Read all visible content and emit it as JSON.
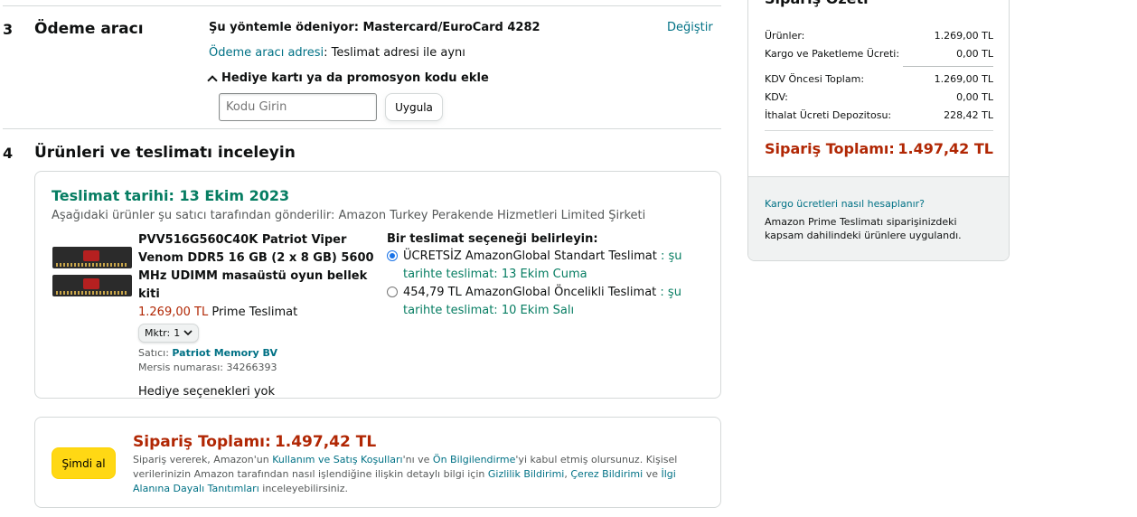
{
  "payment": {
    "step_number": "3",
    "step_title": "Ödeme aracı",
    "method_line": "Şu yöntemle ödeniyor: Mastercard/EuroCard 4282",
    "change_link": "Değiştir",
    "address_link": "Ödeme aracı adresi",
    "address_value": ": Teslimat adresi ile aynı",
    "promo_toggle": "Hediye kartı ya da promosyon kodu ekle",
    "promo_placeholder": "Kodu Girin",
    "apply_button": "Uygula"
  },
  "review": {
    "step_number": "4",
    "step_title": "Ürünleri ve teslimatı inceleyin",
    "delivery_date": "Teslimat tarihi: 13 Ekim 2023",
    "seller_line": "Aşağıdaki ürünler şu satıcı tarafından gönderilir: Amazon Turkey Perakende Hizmetleri Limited Şirketi",
    "product": {
      "title_lines": [
        "PVV516G560C40K Patriot Viper",
        "Venom DDR5 16 GB (2 x 8 GB) 5600",
        "MHz UDIMM masaüstü oyun bellek kiti"
      ],
      "price": "1.269,00 TL",
      "price_suffix": " Prime Teslimat",
      "qty_label": "Mktr:",
      "qty_value": "1",
      "seller_label": "Satıcı:",
      "seller_name": "Patriot Memory BV",
      "mersis": "Mersis numarası: 34266393",
      "gift": "Hediye seçenekleri yok"
    },
    "options_heading": "Bir teslimat seçeneği belirleyin:",
    "options": [
      {
        "selected": true,
        "text": "ÜCRETSİZ AmazonGlobal Standart Teslimat",
        "sep": " : ",
        "date_lines": [
          "şu",
          "tarihte teslimat: 13 Ekim Cuma"
        ]
      },
      {
        "selected": false,
        "text": "454,79 TL AmazonGlobal Öncelikli Teslimat",
        "sep": " : ",
        "date_lines": [
          "şu",
          "tarihte teslimat: 10 Ekim Salı"
        ]
      }
    ]
  },
  "place_order": {
    "button": "Şimdi al",
    "total_label": "Sipariş Toplamı:",
    "total_value": "1.497,42 TL",
    "legal_1": "Sipariş vererek, Amazon'un ",
    "link_terms": "Kullanım ve Satış Koşulları",
    "legal_2": "'nı ve ",
    "link_preinfo": "Ön Bilgilendirme",
    "legal_3": "'yi kabul etmiş olursunuz. Kişisel",
    "legal_4": "verilerinizin Amazon tarafından nasıl işlendiğine ilişkin detaylı bilgi için ",
    "link_privacy": "Gizlilik Bildirimi",
    "legal_5": ", ",
    "link_cookie": "Çerez Bildirimi",
    "legal_6": " ve ",
    "link_ads_1": "İlgi",
    "link_ads_2": "Alanına Dayalı Tanıtımları",
    "legal_7": " inceleyebilirsiniz."
  },
  "summary": {
    "title": "Sipariş Özeti",
    "rows_a": [
      {
        "label": "Ürünler:",
        "value": "1.269,00 TL"
      },
      {
        "label": "Kargo ve Paketleme Ücreti:",
        "value": "0,00 TL"
      }
    ],
    "rows_b": [
      {
        "label": "KDV Öncesi Toplam:",
        "value": "1.269,00 TL"
      },
      {
        "label": "KDV:",
        "value": "0,00 TL"
      },
      {
        "label": "İthalat Ücreti Depozitosu:",
        "value": "228,42 TL"
      }
    ],
    "total_label": "Sipariş Toplamı:",
    "total_value": "1.497,42 TL",
    "shipping_link": "Kargo ücretleri nasıl hesaplanır?",
    "prime_note_1": "Amazon Prime Teslimatı siparişinizdeki",
    "prime_note_2": "kapsam dahilindeki ürünlere uygulandı."
  },
  "colors": {
    "link": "#007185",
    "price": "#b12704",
    "success": "#067d62",
    "buy_button": "#ffd814"
  },
  "icons": [
    "chevron-up-icon",
    "radio-selected-icon",
    "radio-unselected-icon",
    "chevron-down-icon"
  ]
}
